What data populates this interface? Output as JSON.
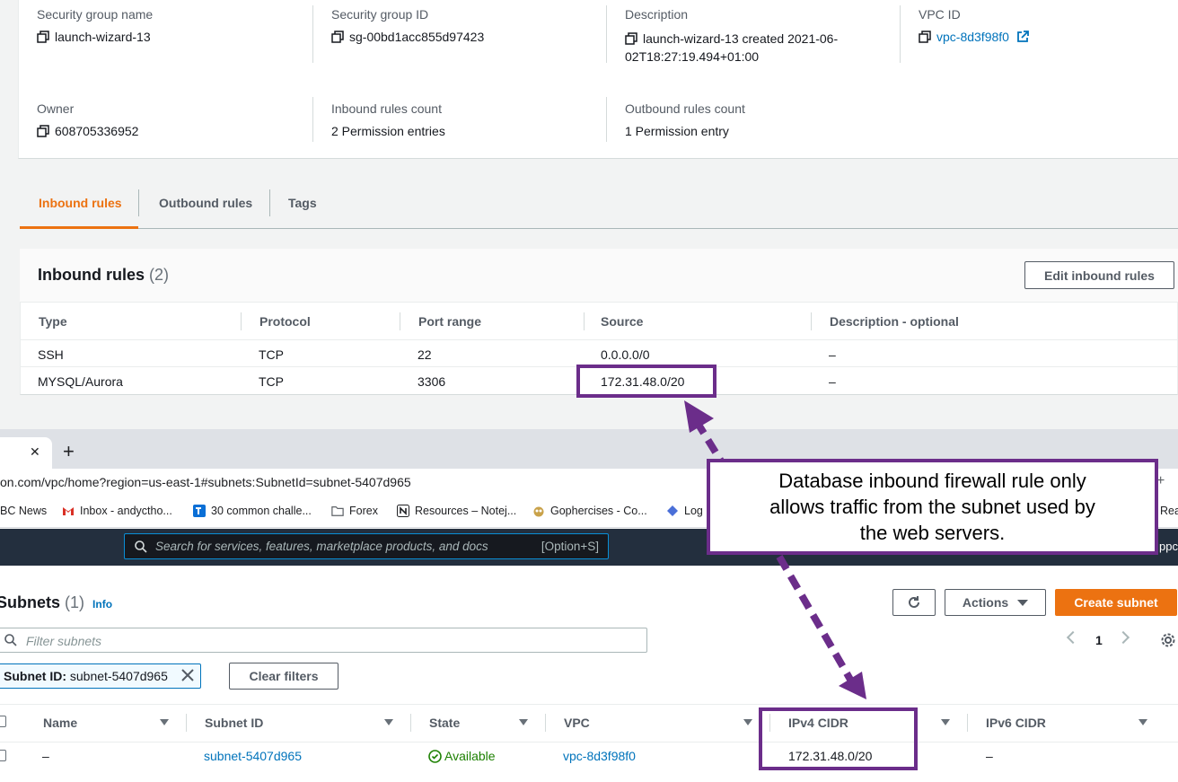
{
  "details": {
    "sg_name_label": "Security group name",
    "sg_name_value": "launch-wizard-13",
    "sg_id_label": "Security group ID",
    "sg_id_value": "sg-00bd1acc855d97423",
    "desc_label": "Description",
    "desc_value_line1": "launch-wizard-13 created 2021-06-",
    "desc_value_line2": "02T18:27:19.494+01:00",
    "vpc_label": "VPC ID",
    "vpc_value": "vpc-8d3f98f0",
    "owner_label": "Owner",
    "owner_value": "608705336952",
    "inbound_count_label": "Inbound rules count",
    "inbound_count_value": "2 Permission entries",
    "outbound_count_label": "Outbound rules count",
    "outbound_count_value": "1 Permission entry"
  },
  "tabs": [
    "Inbound rules",
    "Outbound rules",
    "Tags"
  ],
  "inbound": {
    "title": "Inbound rules",
    "count": "(2)",
    "edit_button": "Edit inbound rules",
    "columns": [
      "Type",
      "Protocol",
      "Port range",
      "Source",
      "Description - optional"
    ],
    "rows": [
      [
        "SSH",
        "TCP",
        "22",
        "0.0.0.0/0",
        "–"
      ],
      [
        "MYSQL/Aurora",
        "TCP",
        "3306",
        "172.31.48.0/20",
        "–"
      ]
    ]
  },
  "browser": {
    "tab_close": "✕",
    "new_tab": "+",
    "url": "on.com/vpc/home?region=us-east-1#subnets:SubnetId=subnet-5407d965",
    "bookmarks": [
      "BC News",
      "Inbox - andyctho...",
      "30 common challe...",
      "Forex",
      "Resources – Notej...",
      "Gophercises - Co...",
      "Log"
    ],
    "bookmark_right": "Rea",
    "right_plus": "+"
  },
  "console": {
    "search_placeholder": "Search for services, features, marketplace products, and docs",
    "search_shortcut": "[Option+S]",
    "right_text": "ppc"
  },
  "subnets": {
    "title": "Subnets",
    "count": "(1)",
    "info": "Info",
    "actions_button": "Actions",
    "create_button": "Create subnet",
    "filter_placeholder": "Filter subnets",
    "page_number": "1",
    "token_key": "Subnet ID:",
    "token_value": "subnet-5407d965",
    "clear_filters": "Clear filters",
    "columns": [
      "Name",
      "Subnet ID",
      "State",
      "VPC",
      "IPv4 CIDR",
      "IPv6 CIDR"
    ],
    "row": {
      "name": "–",
      "subnet_id": "subnet-5407d965",
      "state": "Available",
      "vpc": "vpc-8d3f98f0",
      "ipv4": "172.31.48.0/20",
      "ipv6": "–"
    }
  },
  "annotation": {
    "line1": "Database inbound firewall rule only",
    "line2": "allows traffic from the subnet used by",
    "line3": "the web servers."
  },
  "colors": {
    "accent_orange": "#ec7211",
    "link_blue": "#0073bb",
    "annotation_purple": "#6b2d8a",
    "success_green": "#1d8102",
    "console_nav": "#232f3e"
  }
}
